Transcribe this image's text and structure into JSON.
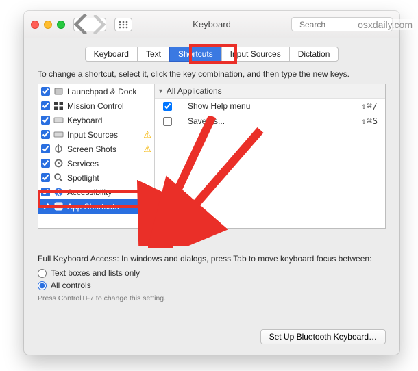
{
  "window": {
    "title": "Keyboard"
  },
  "search": {
    "placeholder": "Search"
  },
  "tabs": [
    {
      "label": "Keyboard",
      "active": false
    },
    {
      "label": "Text",
      "active": false
    },
    {
      "label": "Shortcuts",
      "active": true
    },
    {
      "label": "Input Sources",
      "active": false
    },
    {
      "label": "Dictation",
      "active": false
    }
  ],
  "intro": "To change a shortcut, select it, click the key combination, and then type the new keys.",
  "categories": [
    {
      "label": "Launchpad & Dock",
      "checked": true,
      "warn": false,
      "selected": false
    },
    {
      "label": "Mission Control",
      "checked": true,
      "warn": false,
      "selected": false
    },
    {
      "label": "Keyboard",
      "checked": true,
      "warn": false,
      "selected": false
    },
    {
      "label": "Input Sources",
      "checked": true,
      "warn": true,
      "selected": false
    },
    {
      "label": "Screen Shots",
      "checked": true,
      "warn": true,
      "selected": false
    },
    {
      "label": "Services",
      "checked": true,
      "warn": false,
      "selected": false
    },
    {
      "label": "Spotlight",
      "checked": true,
      "warn": false,
      "selected": false
    },
    {
      "label": "Accessibility",
      "checked": true,
      "warn": false,
      "selected": false
    },
    {
      "label": "App Shortcuts",
      "checked": true,
      "warn": false,
      "selected": true
    }
  ],
  "group_header": "All Applications",
  "shortcuts": [
    {
      "label": "Show Help menu",
      "checked": true,
      "keys": "⇧⌘/"
    },
    {
      "label": "Save As...",
      "checked": false,
      "keys": "⇧⌘S"
    }
  ],
  "fka": {
    "heading": "Full Keyboard Access: In windows and dialogs, press Tab to move keyboard focus between:",
    "opt1": "Text boxes and lists only",
    "opt2": "All controls",
    "hint": "Press Control+F7 to change this setting."
  },
  "buttons": {
    "add": "+",
    "remove": "−",
    "bluetooth": "Set Up Bluetooth Keyboard…"
  },
  "watermark": "osxdaily.com"
}
